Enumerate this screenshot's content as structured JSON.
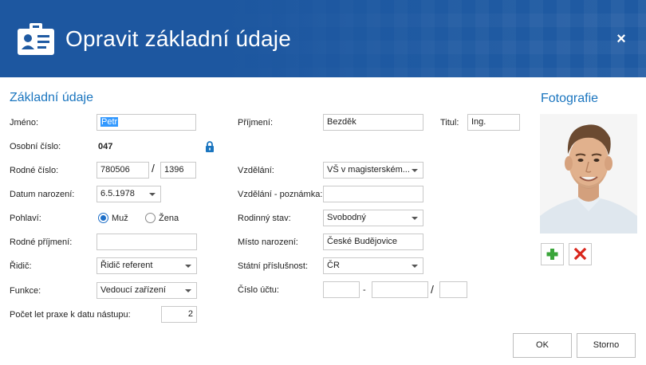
{
  "dialog": {
    "title": "Opravit základní údaje",
    "close_label": "×"
  },
  "sections": {
    "basic": "Základní údaje",
    "photo": "Fotografie"
  },
  "form": {
    "jmeno": {
      "label": "Jméno:",
      "value": "Petr"
    },
    "prijmeni": {
      "label": "Příjmení:",
      "value": "Bezděk"
    },
    "titul": {
      "label": "Titul:",
      "value": "Ing."
    },
    "osobni_cislo": {
      "label": "Osobní číslo:",
      "value": "047"
    },
    "rodne_cislo": {
      "label": "Rodné číslo:",
      "part1": "780506",
      "separator": "/",
      "part2": "1396"
    },
    "vzdelani": {
      "label": "Vzdělání:",
      "value": "VŠ v magisterském..."
    },
    "datum_narozeni": {
      "label": "Datum narození:",
      "value": "6.5.1978"
    },
    "vzdelani_poznamka": {
      "label": "Vzdělání - poznámka:",
      "value": ""
    },
    "pohlavi": {
      "label": "Pohlaví:",
      "options": [
        "Muž",
        "Žena"
      ],
      "selected": "Muž"
    },
    "rodinny_stav": {
      "label": "Rodinný stav:",
      "value": "Svobodný"
    },
    "rodne_prijmeni": {
      "label": "Rodné příjmení:",
      "value": ""
    },
    "misto_narozeni": {
      "label": "Místo narození:",
      "value": "České Budějovice"
    },
    "ridic": {
      "label": "Řidič:",
      "value": "Řidič referent"
    },
    "statni_prislusnost": {
      "label": "Státní příslušnost:",
      "value": "ČR"
    },
    "funkce": {
      "label": "Funkce:",
      "value": "Vedoucí zařízení"
    },
    "cislo_uctu": {
      "label": "Číslo účtu:",
      "prefix": "",
      "dash": "-",
      "number": "",
      "slash": "/",
      "bank": ""
    },
    "pocet_let": {
      "label": "Počet let praxe k datu nástupu:",
      "value": "2"
    }
  },
  "buttons": {
    "ok": "OK",
    "cancel": "Storno"
  },
  "colors": {
    "header_bg": "#1f5aa2",
    "accent": "#1a75bf",
    "add_green": "#3aa53a",
    "remove_red": "#d9261c"
  },
  "icons": {
    "header": "id-card-icon",
    "lock": "lock-icon",
    "add": "plus-icon",
    "remove": "x-icon"
  }
}
